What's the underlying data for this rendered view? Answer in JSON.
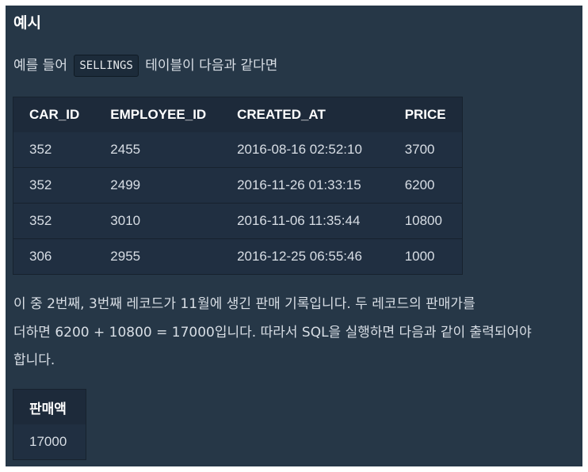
{
  "section": {
    "heading": "예시"
  },
  "intro": {
    "prefix": "예를 들어",
    "table_name": "SELLINGS",
    "suffix": "테이블이 다음과 같다면"
  },
  "sellings_table": {
    "columns": [
      "CAR_ID",
      "EMPLOYEE_ID",
      "CREATED_AT",
      "PRICE"
    ],
    "rows": [
      [
        "352",
        "2455",
        "2016-08-16 02:52:10",
        "3700"
      ],
      [
        "352",
        "2499",
        "2016-11-26 01:33:15",
        "6200"
      ],
      [
        "352",
        "3010",
        "2016-11-06 11:35:44",
        "10800"
      ],
      [
        "306",
        "2955",
        "2016-12-25 06:55:46",
        "1000"
      ]
    ]
  },
  "explanation": {
    "line1": "이 중 2번째, 3번째 레코드가 11월에 생긴 판매 기록입니다. 두 레코드의 판매가를",
    "line2": "더하면 6200 + 10800 = 17000입니다. 따라서 SQL을 실행하면 다음과 같이 출력되어야",
    "line3": "합니다."
  },
  "result_table": {
    "columns": [
      "판매액"
    ],
    "rows": [
      [
        "17000"
      ]
    ]
  },
  "colors": {
    "panel_background": "#263747",
    "table_header_background": "#1d2a3a",
    "table_cell_background": "#202f41",
    "text": "#d8dee5"
  }
}
